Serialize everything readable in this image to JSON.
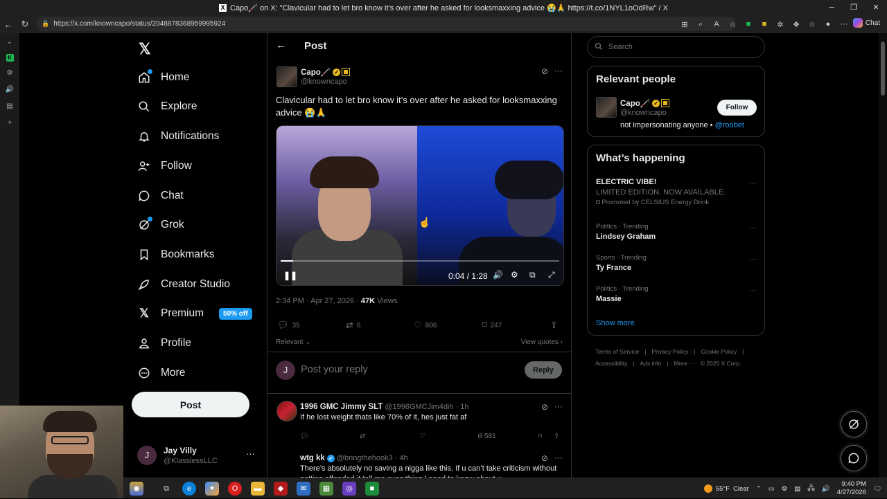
{
  "browser": {
    "window_title": "Capo🦯 on X: \"Clavicular had to let bro know it’s over after he asked for looksmaxxing advice 😭🙏 https://t.co/1NYL1oOdRw\" / X",
    "url": "https://x.com/knowncapo/status/2048878368959995924",
    "chat_label": "Chat"
  },
  "nav": {
    "items": [
      {
        "label": "Home",
        "icon": "home-icon"
      },
      {
        "label": "Explore",
        "icon": "search-icon"
      },
      {
        "label": "Notifications",
        "icon": "bell-icon"
      },
      {
        "label": "Follow",
        "icon": "person-add-icon"
      },
      {
        "label": "Chat",
        "icon": "chat-icon"
      },
      {
        "label": "Grok",
        "icon": "grok-icon"
      },
      {
        "label": "Bookmarks",
        "icon": "bookmark-icon"
      },
      {
        "label": "Creator Studio",
        "icon": "rocket-icon"
      },
      {
        "label": "Premium",
        "icon": "x-icon"
      },
      {
        "label": "Profile",
        "icon": "person-icon"
      },
      {
        "label": "More",
        "icon": "more-circle-icon"
      }
    ],
    "premium_badge": "50% off",
    "post_label": "Post",
    "me": {
      "initial": "J",
      "name": "Jay Villy",
      "handle": "@KlasslessLLC"
    }
  },
  "header": {
    "title": "Post"
  },
  "tweet": {
    "author_name": "Capo🦯",
    "author_handle": "@knowncapo",
    "text": "Clavicular had to let bro know it’s over after he asked for looksmaxxing advice 😭🙏",
    "video": {
      "time": "0:04 / 1:28",
      "progress": 0.045
    },
    "timestamp": "2:34 PM · Apr 27, 2026 · ",
    "views_count": "47K",
    "views_label": " Views",
    "replies": "35",
    "reposts": "6",
    "likes": "806",
    "bookmarks": "247",
    "sort_label": "Relevant",
    "view_quotes": "View quotes"
  },
  "reply_box": {
    "initial": "J",
    "placeholder": "Post your reply",
    "button": "Reply"
  },
  "replies": [
    {
      "name": "1996 GMC Jimmy SLT",
      "handle": "@1996GMCJim4dih · 1h",
      "text": "If he lost weight thats like 70% of it, hes just fat af",
      "views": "581"
    },
    {
      "name": "wtg kk",
      "handle": "@bringthehook3 · 4h",
      "text": "There’s absolutely no saving a nigga like this. If u can’t take criticism without getting offended it tell me everything I need to know about u"
    }
  ],
  "search": {
    "placeholder": "Search"
  },
  "relevant_people": {
    "title": "Relevant people",
    "name": "Capo🦯",
    "handle": "@knowncapo",
    "bio": "not impersonating anyone • ",
    "bio_link": "@roobet",
    "follow": "Follow"
  },
  "happening": {
    "title": "What’s happening",
    "ad": {
      "title": "ELECTRIC VIBE!",
      "subtitle": "LIMITED EDITION. NOW AVAILABLE.",
      "promoted": "Promoted by CELSIUS Energy Drink"
    },
    "trends": [
      {
        "meta": "Politics · Trending",
        "name": "Lindsey Graham"
      },
      {
        "meta": "Sports · Trending",
        "name": "Ty France"
      },
      {
        "meta": "Politics · Trending",
        "name": "Massie"
      }
    ],
    "show_more": "Show more"
  },
  "footer": [
    "Terms of Service",
    "|",
    "Privacy Policy",
    "|",
    "Cookie Policy",
    "|",
    "Accessibility",
    "|",
    "Ads info",
    "|",
    "More ···",
    "© 2026 X Corp."
  ],
  "taskbar": {
    "temp": "55°F",
    "weather": "Clear",
    "time": "9:40 PM",
    "date": "4/27/2026"
  },
  "colors": {
    "accent": "#1d9bf0",
    "background": "#000000",
    "border": "#2f3336",
    "muted": "#71767b"
  }
}
